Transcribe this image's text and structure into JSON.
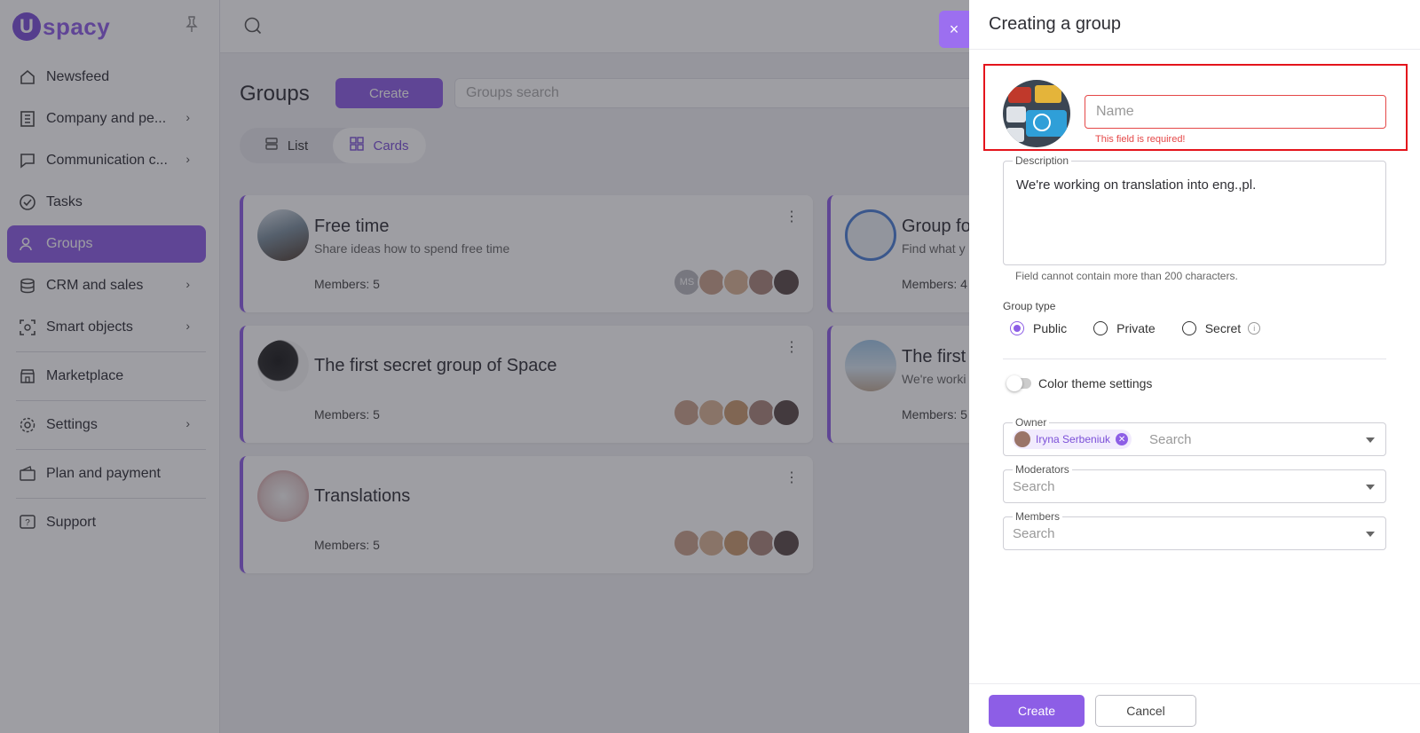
{
  "app": {
    "logo_letter": "U",
    "logo_text": "spacy"
  },
  "sidebar": {
    "items": [
      {
        "label": "Newsfeed",
        "icon": "home-icon"
      },
      {
        "label": "Company and pe...",
        "icon": "building-icon"
      },
      {
        "label": "Communication c...",
        "icon": "chat-icon"
      },
      {
        "label": "Tasks",
        "icon": "check-circle-icon"
      },
      {
        "label": "Groups",
        "icon": "users-icon"
      },
      {
        "label": "CRM and sales",
        "icon": "database-icon"
      },
      {
        "label": "Smart objects",
        "icon": "scan-icon"
      },
      {
        "label": "Marketplace",
        "icon": "store-icon"
      },
      {
        "label": "Settings",
        "icon": "gear-icon"
      },
      {
        "label": "Plan and payment",
        "icon": "wallet-icon"
      },
      {
        "label": "Support",
        "icon": "help-icon"
      }
    ]
  },
  "main": {
    "title": "Groups",
    "create_label": "Create",
    "search_placeholder": "Groups search",
    "view": {
      "list": "List",
      "cards": "Cards"
    },
    "cards": [
      {
        "title": "Free time",
        "desc": "Share ideas how to spend free time",
        "members": "Members: 5",
        "initials": "MS"
      },
      {
        "title": "Group fo",
        "desc": "Find what y",
        "members": "Members: 4"
      },
      {
        "title": "The first secret group of Space",
        "desc": "",
        "members": "Members: 5"
      },
      {
        "title": "The first",
        "desc": "We're worki",
        "members": "Members: 5"
      },
      {
        "title": "Translations",
        "desc": "",
        "members": "Members: 5"
      }
    ]
  },
  "drawer": {
    "title": "Creating a group",
    "close": "×",
    "name_placeholder": "Name",
    "name_error": "This field is required!",
    "description_label": "Description",
    "description_value": "We're working on translation into eng.,pl.",
    "description_hint": "Field cannot contain more than 200 characters.",
    "group_type_label": "Group type",
    "group_types": [
      "Public",
      "Private",
      "Secret"
    ],
    "group_type_selected": "Public",
    "color_theme_label": "Color theme settings",
    "owner_label": "Owner",
    "owner_chip": "Iryna Serbeniuk",
    "moderators_label": "Moderators",
    "members_label": "Members",
    "search_placeholder": "Search",
    "create_button": "Create",
    "cancel_button": "Cancel"
  },
  "colors": {
    "accent": "#8d5ee6",
    "error": "#e54848",
    "highlight": "#e4141c"
  }
}
